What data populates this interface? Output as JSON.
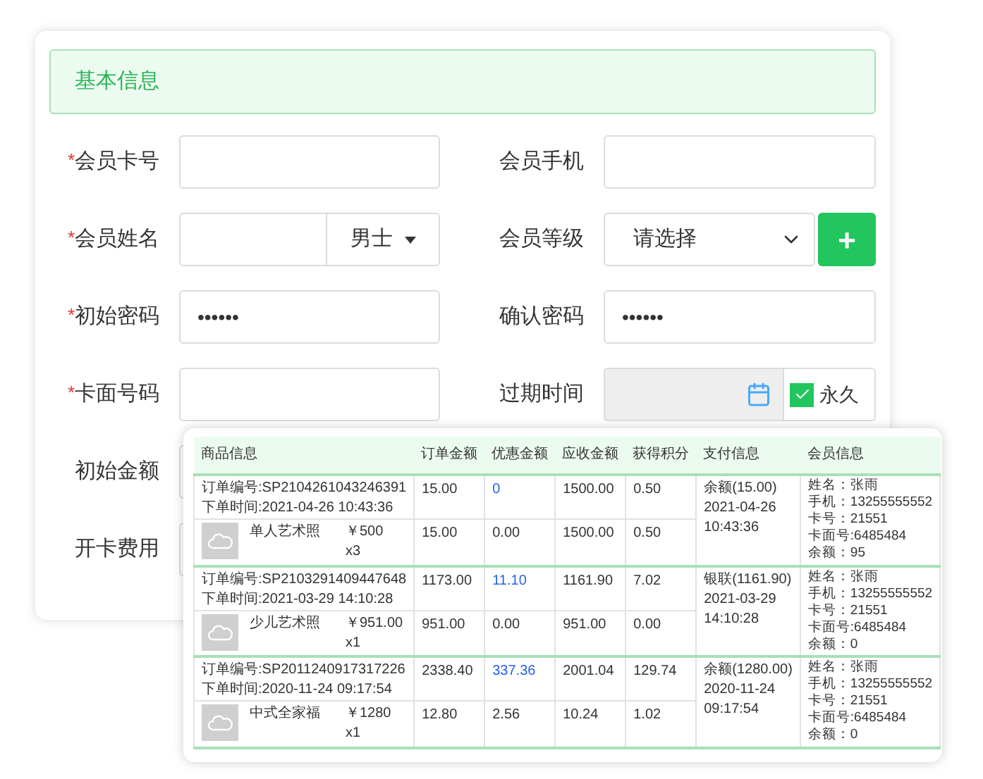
{
  "form": {
    "section_title": "基本信息",
    "rows": [
      {
        "left": {
          "label": "会员卡号",
          "required_mark": "*",
          "kind": "text"
        },
        "right": {
          "label": "会员手机",
          "kind": "text"
        }
      },
      {
        "left": {
          "label": "会员姓名",
          "required_mark": "*",
          "kind": "gender",
          "option": "男士"
        },
        "right": {
          "label": "会员等级",
          "kind": "select",
          "value": "请选择",
          "button": "+"
        }
      },
      {
        "left": {
          "label": "初始密码",
          "required_mark": "*",
          "kind": "text",
          "value": "••••••"
        },
        "right": {
          "label": "确认密码",
          "kind": "text",
          "value": "••••••"
        }
      },
      {
        "left": {
          "label": "卡面号码",
          "required_mark": "*",
          "kind": "text"
        },
        "right": {
          "label": "过期时间",
          "kind": "date",
          "permanent": {
            "label": "永久",
            "checked": true
          }
        }
      },
      {
        "left": {
          "label": "初始金额",
          "kind": "text"
        }
      },
      {
        "left": {
          "label": "开卡费用",
          "kind": "text"
        }
      }
    ]
  },
  "orders_table": {
    "columns": [
      "商品信息",
      "订单金额",
      "优惠金额",
      "应收金额",
      "获得积分",
      "支付信息",
      "会员信息"
    ],
    "orders": [
      {
        "order_no": "订单编号:SP2104261043246391",
        "order_time": "下单时间:2021-04-26 10:43:36",
        "amount": "15.00",
        "discount": "0",
        "receivable": "1500.00",
        "points": "0.50",
        "payment": [
          "余额(15.00)",
          "2021-04-26",
          "10:43:36"
        ],
        "member": [
          "姓名：张雨",
          "手机：13255555552",
          "卡号：21551",
          "卡面号:6485484",
          "余额：95"
        ],
        "item": {
          "name": "单人艺术照",
          "price": "￥500",
          "qty": "x3",
          "amount": "15.00",
          "discount": "0.00",
          "receivable": "1500.00",
          "points": "0.50"
        }
      },
      {
        "order_no": "订单编号:SP2103291409447648",
        "order_time": "下单时间:2021-03-29 14:10:28",
        "amount": "1173.00",
        "discount": "11.10",
        "receivable": "1161.90",
        "points": "7.02",
        "payment": [
          "银联(1161.90)",
          "2021-03-29",
          "14:10:28"
        ],
        "member": [
          "姓名：张雨",
          "手机：13255555552",
          "卡号：21551",
          "卡面号:6485484",
          "余额：0"
        ],
        "item": {
          "name": "少儿艺术照",
          "price": "￥951.00",
          "qty": "x1",
          "amount": "951.00",
          "discount": "0.00",
          "receivable": "951.00",
          "points": "0.00"
        }
      },
      {
        "order_no": "订单编号:SP2011240917317226",
        "order_time": "下单时间:2020-11-24 09:17:54",
        "amount": "2338.40",
        "discount": "337.36",
        "receivable": "2001.04",
        "points": "129.74",
        "payment": [
          "余额(1280.00)",
          "2020-11-24",
          "09:17:54"
        ],
        "member": [
          "姓名：张雨",
          "手机：13255555552",
          "卡号：21551",
          "卡面号:6485484",
          "余额：0"
        ],
        "item": {
          "name": "中式全家福",
          "price": "￥1280",
          "qty": "x1",
          "amount": "12.80",
          "discount": "2.56",
          "receivable": "10.24",
          "points": "1.02"
        }
      }
    ]
  }
}
